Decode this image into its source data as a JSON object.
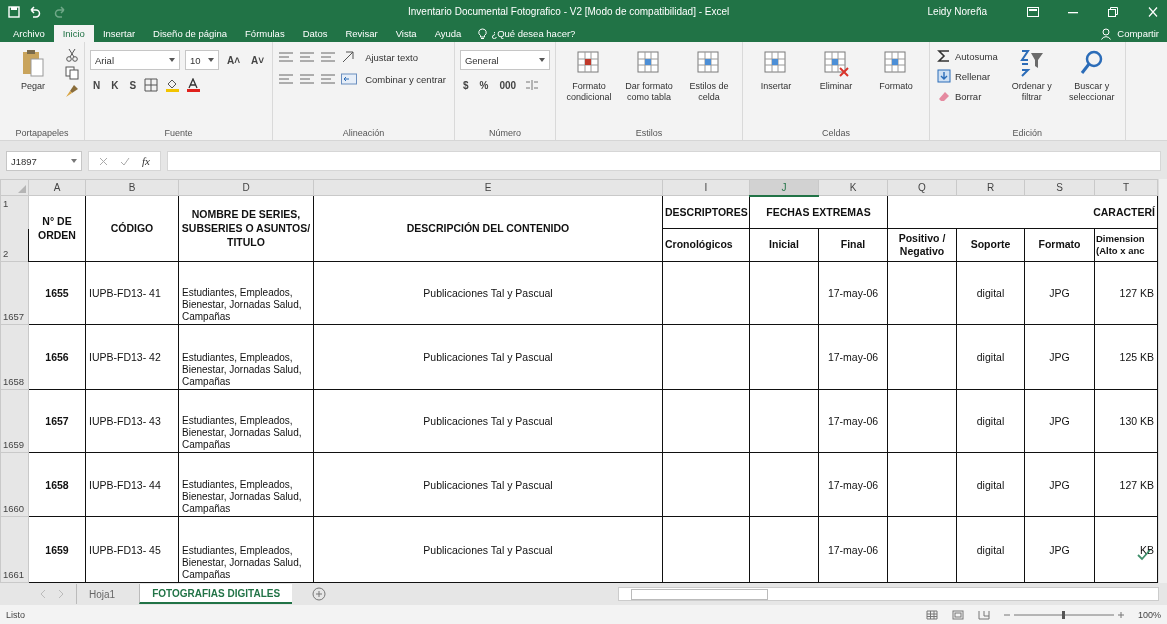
{
  "window": {
    "title": "Inventario Documental Fotografico - V2  [Modo de compatibilidad]  -  Excel",
    "user": "Leidy Noreña"
  },
  "menu_tabs": [
    {
      "label": "Archivo",
      "selected": false
    },
    {
      "label": "Inicio",
      "selected": true
    },
    {
      "label": "Insertar",
      "selected": false
    },
    {
      "label": "Diseño de página",
      "selected": false
    },
    {
      "label": "Fórmulas",
      "selected": false
    },
    {
      "label": "Datos",
      "selected": false
    },
    {
      "label": "Revisar",
      "selected": false
    },
    {
      "label": "Vista",
      "selected": false
    },
    {
      "label": "Ayuda",
      "selected": false
    }
  ],
  "tell_me": "¿Qué desea hacer?",
  "share": "Compartir",
  "ribbon": [
    {
      "label": "Portapapeles",
      "items": [
        {
          "kind": "large",
          "label": "Pegar"
        },
        {
          "kind": "tools"
        }
      ]
    },
    {
      "label": "Fuente",
      "items": [
        {
          "kind": "rows",
          "rows": [
            [
              {
                "kind": "field",
                "value": "Arial"
              },
              {
                "kind": "field",
                "value": "10"
              },
              {
                "kind": "glyph",
                "label": "A˄"
              },
              {
                "kind": "glyph",
                "label": "A˅"
              }
            ],
            [
              {
                "kind": "glyph",
                "label": "N"
              },
              {
                "kind": "glyph",
                "label": "K"
              },
              {
                "kind": "glyph",
                "label": "S"
              },
              {
                "kind": "icon"
              },
              {
                "kind": "icon"
              },
              {
                "kind": "icon"
              }
            ]
          ]
        }
      ]
    },
    {
      "label": "Alineación",
      "items": [
        {
          "kind": "rows",
          "rows": [
            [
              {
                "kind": "icon"
              },
              {
                "kind": "icon"
              },
              {
                "kind": "icon"
              },
              {
                "kind": "icon"
              },
              {
                "kind": "text",
                "label": "Ajustar texto"
              }
            ],
            [
              {
                "kind": "icon"
              },
              {
                "kind": "icon"
              },
              {
                "kind": "icon"
              },
              {
                "kind": "icon"
              },
              {
                "kind": "text",
                "label": "Combinar y centrar"
              }
            ]
          ]
        }
      ]
    },
    {
      "label": "Número",
      "items": [
        {
          "kind": "rows",
          "rows": [
            [
              {
                "kind": "field",
                "value": "General"
              }
            ],
            [
              {
                "kind": "glyph",
                "label": "$"
              },
              {
                "kind": "glyph",
                "label": "%"
              },
              {
                "kind": "glyph",
                "label": "000"
              },
              {
                "kind": "icon"
              }
            ]
          ]
        }
      ]
    },
    {
      "label": "Estilos",
      "items": [
        {
          "kind": "large",
          "label": "Formato condicional"
        },
        {
          "kind": "large",
          "label": "Dar formato como tabla"
        },
        {
          "kind": "large",
          "label": "Estilos de celda"
        }
      ]
    },
    {
      "label": "Celdas",
      "items": [
        {
          "kind": "large",
          "label": "Insertar"
        },
        {
          "kind": "large",
          "label": "Eliminar"
        },
        {
          "kind": "large",
          "label": "Formato"
        }
      ]
    },
    {
      "label": "Edición",
      "items": [
        {
          "kind": "stack",
          "items": [
            {
              "label": "Autosuma"
            },
            {
              "label": "Rellenar"
            },
            {
              "label": "Borrar"
            }
          ]
        },
        {
          "kind": "large",
          "label": "Ordenar y filtrar"
        },
        {
          "kind": "large",
          "label": "Buscar y seleccionar"
        }
      ]
    }
  ],
  "name_box": "J1897",
  "formula_label": "fx",
  "columns": [
    {
      "label": "A",
      "selected": false
    },
    {
      "label": "B",
      "selected": false
    },
    {
      "label": "D",
      "selected": false
    },
    {
      "label": "E",
      "selected": false
    },
    {
      "label": "I",
      "selected": false
    },
    {
      "label": "J",
      "selected": true
    },
    {
      "label": "K",
      "selected": false
    },
    {
      "label": "Q",
      "selected": false
    },
    {
      "label": "R",
      "selected": false
    },
    {
      "label": "S",
      "selected": false
    },
    {
      "label": "T",
      "selected": false
    }
  ],
  "header": {
    "row_numbers": [
      "1",
      "2"
    ],
    "orden": "N° DE ORDEN",
    "codigo": "CÓDIGO",
    "nombre": "NOMBRE DE SERIES, SUBSERIES O ASUNTOS/ TITULO",
    "descripcion": "DESCRIPCIÓN DEL CONTENIDO",
    "descriptores": "DESCRIPTORES",
    "fechas": "FECHAS EXTREMAS",
    "caracteristicas": "CARACTERÍ",
    "cronologicos": "Cronológicos",
    "inicial": "Inicial",
    "final": "Final",
    "positivo": "Positivo / Negativo",
    "soporte": "Soporte",
    "formato": "Formato",
    "dimension": "Dimension (Alto x anc"
  },
  "rows": [
    {
      "row_number": "1657",
      "orden": "1655",
      "codigo": "IUPB-FD13- 41",
      "nombre": "Estudiantes, Empleados, Bienestar, Jornadas Salud, Campañas",
      "descripcion": "Publicaciones Tal y Pascual",
      "final": "17-may-06",
      "soporte": "digital",
      "formato": "JPG",
      "dimension": "127 KB"
    },
    {
      "row_number": "1658",
      "orden": "1656",
      "codigo": "IUPB-FD13- 42",
      "nombre": "Estudiantes, Empleados, Bienestar, Jornadas Salud, Campañas",
      "descripcion": "Publicaciones Tal y Pascual",
      "final": "17-may-06",
      "soporte": "digital",
      "formato": "JPG",
      "dimension": "125 KB"
    },
    {
      "row_number": "1659",
      "orden": "1657",
      "codigo": "IUPB-FD13- 43",
      "nombre": "Estudiantes, Empleados, Bienestar, Jornadas Salud, Campañas",
      "descripcion": "Publicaciones Tal y Pascual",
      "final": "17-may-06",
      "soporte": "digital",
      "formato": "JPG",
      "dimension": "130 KB"
    },
    {
      "row_number": "1660",
      "orden": "1658",
      "codigo": "IUPB-FD13- 44",
      "nombre": "Estudiantes, Empleados, Bienestar, Jornadas Salud, Campañas",
      "descripcion": "Publicaciones Tal y Pascual",
      "final": "17-may-06",
      "soporte": "digital",
      "formato": "JPG",
      "dimension": "127 KB"
    },
    {
      "row_number": "1661",
      "orden": "1659",
      "codigo": "IUPB-FD13- 45",
      "nombre": "Estudiantes, Empleados, Bienestar, Jornadas Salud, Campañas",
      "descripcion": "Publicaciones Tal y Pascual",
      "final": "17-may-06",
      "soporte": "digital",
      "formato": "JPG",
      "dimension": "KB"
    }
  ],
  "sheet_tabs": [
    {
      "label": "Hoja1",
      "selected": false
    },
    {
      "label": "FOTOGRAFIAS DIGITALES",
      "selected": true
    }
  ],
  "status": "Listo",
  "zoom": "100%"
}
